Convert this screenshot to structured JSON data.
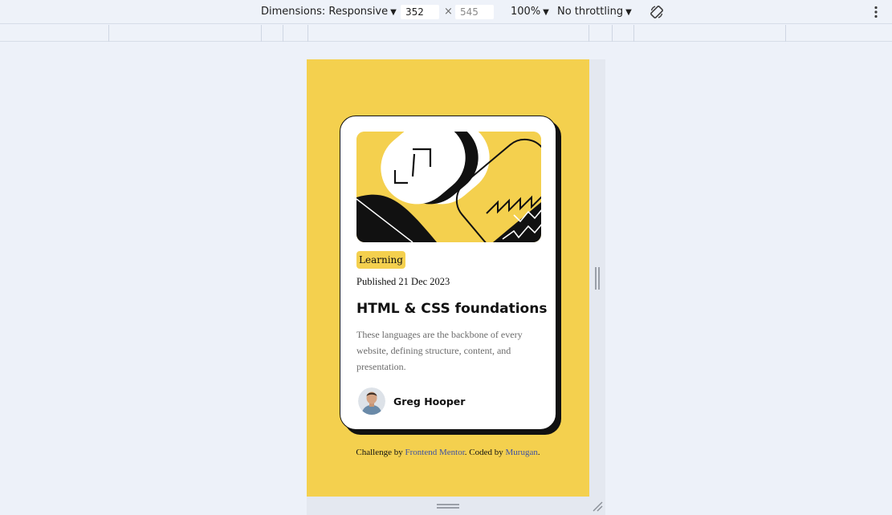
{
  "toolbar": {
    "dimensions_label": "Dimensions: Responsive",
    "width_value": "352",
    "times_sign": "×",
    "height_value": "545",
    "zoom": "100%",
    "throttling": "No throttling",
    "caret": "▼",
    "icons": [
      "rotate-icon",
      "more-vert-icon"
    ]
  },
  "card": {
    "tag": "Learning",
    "published": "Published 21 Dec 2023",
    "title": "HTML & CSS foundations",
    "description": "These languages are the backbone of every website, defining structure, content, and presentation.",
    "author": "Greg Hooper",
    "illustration_icon": "illustration-article",
    "avatar_icon": "avatar-greg-hooper"
  },
  "attribution": {
    "prefix": "Challenge by",
    "frontend_mentor": "Frontend Mentor",
    "middle": ". Coded by",
    "coder": "Murugan",
    "suffix": "."
  },
  "colors": {
    "page_background": "#f4d04e",
    "card_background": "#ffffff",
    "shadow": "#111111",
    "link": "#3e52a3",
    "devtools_background": "#edf1f9"
  }
}
